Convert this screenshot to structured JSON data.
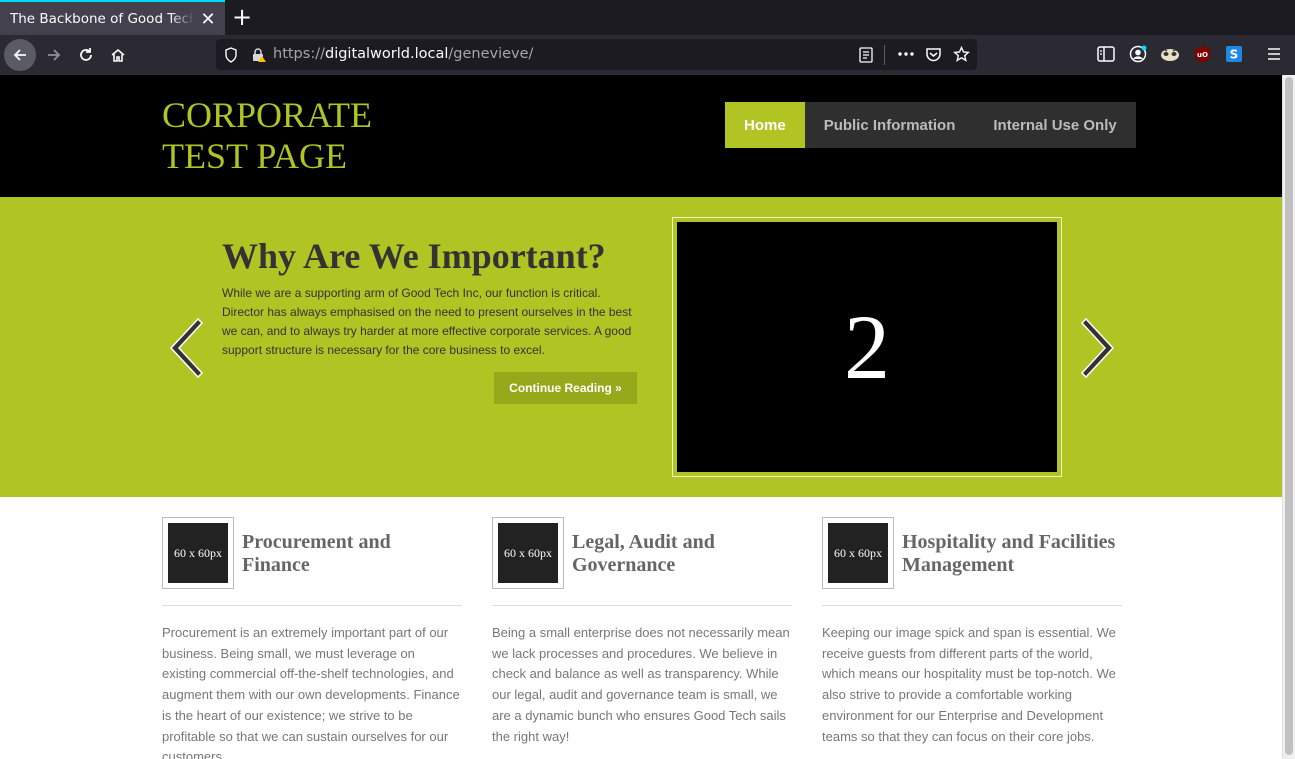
{
  "browser": {
    "tab_title": "The Backbone of Good Tech",
    "tab_close": "✕",
    "new_tab": "+",
    "url_scheme": "https://",
    "url_host": "digitalworld.local",
    "url_path": "/genevieve/"
  },
  "site": {
    "logo_line1": "CORPORATE",
    "logo_line2": "TEST PAGE",
    "menu": [
      "Home",
      "Public Information",
      "Internal Use Only"
    ],
    "active_menu": "Home",
    "brand_color": "#b1c424"
  },
  "hero": {
    "title": "Why Are We Important?",
    "text": "While we are a supporting arm of Good Tech Inc, our function is critical. Director has always emphasised on the need to present ourselves in the best we can, and to always try harder at more effective corporate services. A good support structure is necessary for the core business to excel.",
    "button": "Continue Reading »",
    "slide_number": "2"
  },
  "features": [
    {
      "thumb": "60 x 60px",
      "title": "Procurement and Finance",
      "text": "Procurement is an extremely important part of our business. Being small, we must leverage on existing commercial off-the-shelf technologies, and augment them with our own developments. Finance is the heart of our existence; we strive to be profitable so that we can sustain ourselves for our customers."
    },
    {
      "thumb": "60 x 60px",
      "title": "Legal, Audit and Governance",
      "text": "Being a small enterprise does not necessarily mean we lack processes and procedures. We believe in check and balance as well as transparency. While our legal, audit and governance team is small, we are a dynamic bunch who ensures Good Tech sails the right way!"
    },
    {
      "thumb": "60 x 60px",
      "title": "Hospitality and Facilities Management",
      "text": "Keeping our image spick and span is essential. We receive guests from different parts of the world, which means our hospitality must be top-notch. We also strive to provide a comfortable working environment for our Enterprise and Development teams so that they can focus on their core jobs."
    }
  ]
}
